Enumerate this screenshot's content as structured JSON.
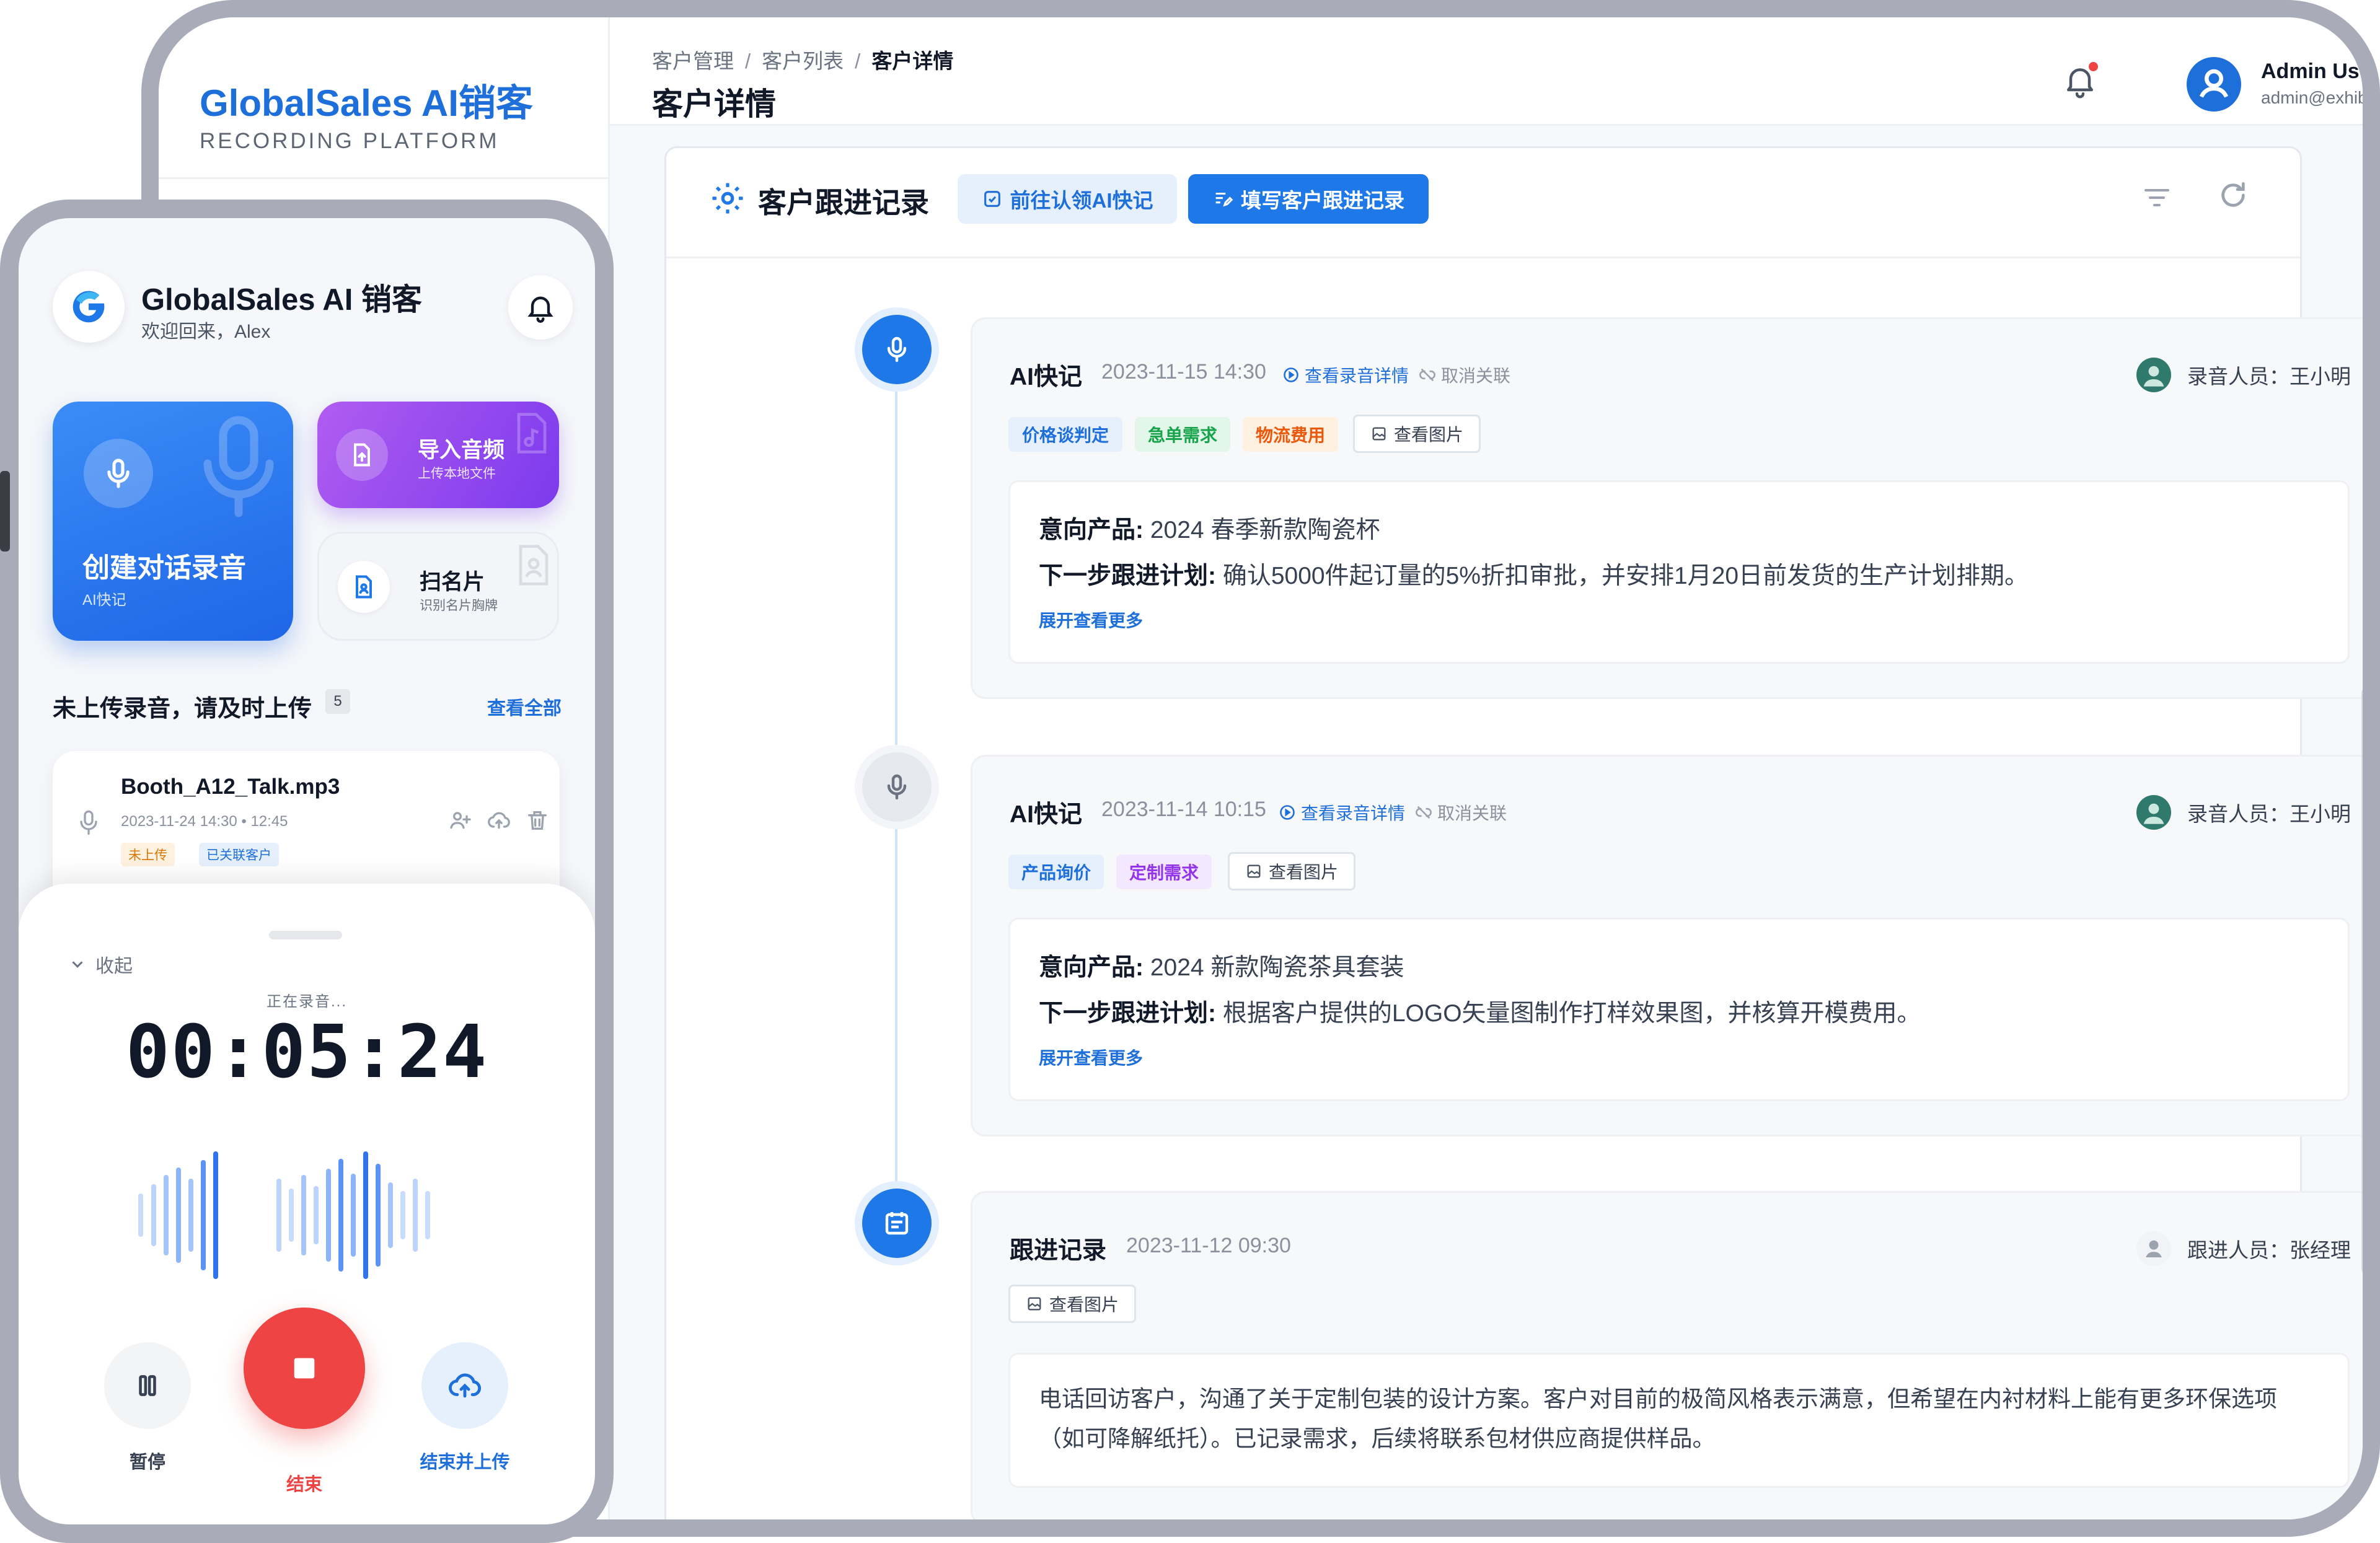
{
  "tablet": {
    "brand": {
      "title": "GlobalSales AI销客",
      "subtitle": "RECORDING PLATFORM"
    },
    "breadcrumb": [
      "客户管理",
      "客户列表",
      "客户详情"
    ],
    "breadcrumb_sep": "/",
    "page_title": "客户详情",
    "user": {
      "name": "Admin User",
      "email": "admin@exhibition.ai"
    },
    "section": {
      "title": "客户跟进记录",
      "btn_claim": "前往认领AI快记",
      "btn_fill": "填写客户跟进记录"
    },
    "entries": [
      {
        "title": "AI快记",
        "time": "2023-11-15 14:30",
        "link": "查看录音详情",
        "unlink": "取消关联",
        "recorder": "录音人员：王小明",
        "tags": [
          {
            "label": "价格谈判定",
            "color": "#1e6fd9",
            "bg": "#e6f0fd"
          },
          {
            "label": "急单需求",
            "color": "#16a34a",
            "bg": "#e3f6ea"
          },
          {
            "label": "物流费用",
            "color": "#ea580c",
            "bg": "#fff0e0"
          }
        ],
        "view_image": "查看图片",
        "product_label": "意向产品:",
        "product": "2024 春季新款陶瓷杯",
        "plan_label": "下一步跟进计划:",
        "plan": "确认5000件起订量的5%折扣审批，并安排1月20日前发货的生产计划排期。",
        "expand": "展开查看更多"
      },
      {
        "title": "AI快记",
        "time": "2023-11-14 10:15",
        "link": "查看录音详情",
        "unlink": "取消关联",
        "recorder": "录音人员：王小明",
        "tags": [
          {
            "label": "产品询价",
            "color": "#1e6fd9",
            "bg": "#e6f0fd"
          },
          {
            "label": "定制需求",
            "color": "#9333ea",
            "bg": "#f3e8fd"
          }
        ],
        "view_image": "查看图片",
        "product_label": "意向产品:",
        "product": "2024 新款陶瓷茶具套装",
        "plan_label": "下一步跟进计划:",
        "plan": "根据客户提供的LOGO矢量图制作打样效果图，并核算开模费用。",
        "expand": "展开查看更多"
      },
      {
        "title": "跟进记录",
        "time": "2023-11-12 09:30",
        "recorder": "跟进人员：张经理",
        "view_image": "查看图片",
        "content": "电话回访客户，沟通了关于定制包装的设计方案。客户对目前的极简风格表示满意，但希望在内衬材料上能有更多环保选项（如可降解纸托）。已记录需求，后续将联系包材供应商提供样品。"
      }
    ]
  },
  "phone": {
    "app_name": "GlobalSales AI 销客",
    "welcome": "欢迎回来，Alex",
    "tiles": {
      "record": {
        "title": "创建对话录音",
        "sub": "AI快记"
      },
      "import": {
        "title": "导入音频",
        "sub": "上传本地文件"
      },
      "scan": {
        "title": "扫名片",
        "sub": "识别名片胸牌"
      }
    },
    "pending": {
      "title": "未上传录音，请及时上传",
      "count": "5",
      "view_all": "查看全部"
    },
    "file": {
      "name": "Booth_A12_Talk.mp3",
      "meta": "2023-11-24 14:30  •  12:45",
      "tag_unuploaded": "未上传",
      "tag_linked": "已关联客户"
    },
    "recorder": {
      "collapse": "收起",
      "status": "正在录音...",
      "timer": "00:05:24",
      "pause": "暂停",
      "stop": "结束",
      "finish": "结束并上传"
    }
  },
  "colors": {
    "primary": "#1e78e8",
    "danger": "#ef4444",
    "purple": "#7c3aed"
  }
}
